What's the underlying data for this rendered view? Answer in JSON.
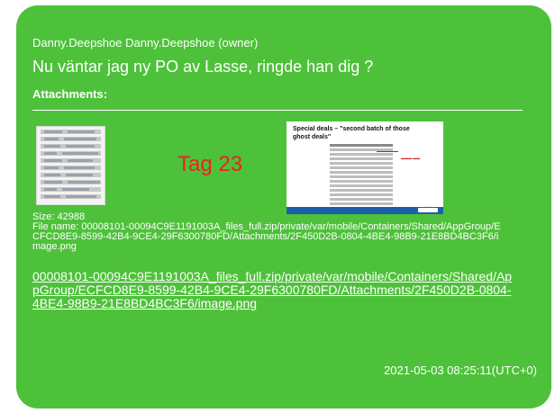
{
  "message": {
    "sender": "Danny.Deepshoe Danny.Deepshoe (owner)",
    "text": "Nu väntar jag ny PO av Lasse, ringde han dig ?",
    "attachments_heading": "Attachments:",
    "tag_label": "Tag 23",
    "slide_title": "Special deals – \"second batch of those ghost deals\"",
    "size_text": "Size: 42988",
    "file_name_text": "File name: 00008101-00094C9E1191003A_files_full.zip/private/var/mobile/Containers/Shared/AppGroup/ECFCD8E9-8599-42B4-9CE4-29F6300780FD/Attachments/2F450D2B-0804-4BE4-98B9-21E8BD4BC3F6/image.png",
    "link_text": "00008101-00094C9E1191003A_files_full.zip/private/var/mobile/Containers/Shared/AppGroup/ECFCD8E9-8599-42B4-9CE4-29F6300780FD/Attachments/2F450D2B-0804-4BE4-98B9-21E8BD4BC3F6/image.png",
    "timestamp": "2021-05-03 08:25:11(UTC+0)"
  },
  "colors": {
    "bubble": "#4ec13a",
    "text": "#ffffff",
    "tag": "#e8251d"
  }
}
